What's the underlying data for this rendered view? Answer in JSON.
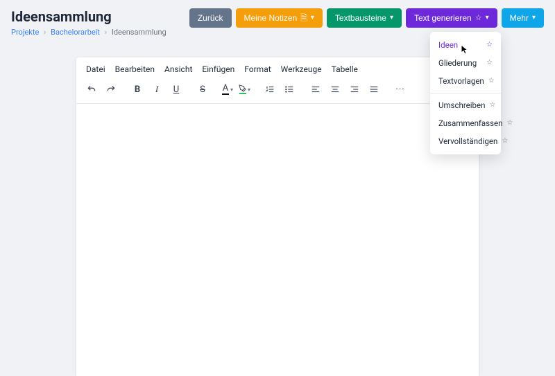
{
  "header": {
    "title": "Ideensammlung",
    "breadcrumb": {
      "items": [
        "Projekte",
        "Bachelorarbeit",
        "Ideensammlung"
      ]
    },
    "buttons": {
      "back": "Zurück",
      "notes": "Meine Notizen",
      "blocks": "Textbausteine",
      "generate": "Text generieren",
      "more": "Mehr"
    }
  },
  "dropdown": {
    "group1": [
      {
        "label": "Ideen",
        "active": true
      },
      {
        "label": "Gliederung",
        "active": false
      },
      {
        "label": "Textvorlagen",
        "active": false
      }
    ],
    "group2": [
      {
        "label": "Umschreiben",
        "active": false
      },
      {
        "label": "Zusammenfassen",
        "active": false
      },
      {
        "label": "Vervollständigen",
        "active": false
      }
    ]
  },
  "editor": {
    "menubar": [
      "Datei",
      "Bearbeiten",
      "Ansicht",
      "Einfügen",
      "Format",
      "Werkzeuge",
      "Tabelle"
    ]
  }
}
